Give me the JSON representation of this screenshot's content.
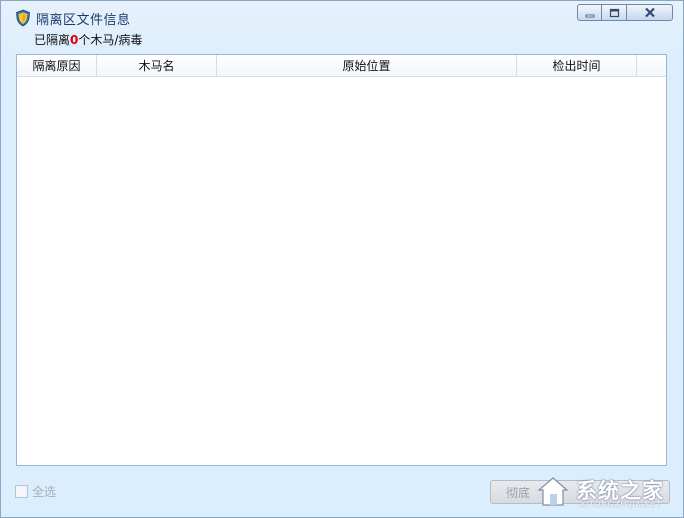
{
  "window": {
    "title": "隔离区文件信息",
    "summary_prefix": "已隔离",
    "summary_count": "0",
    "summary_suffix": "个木马/病毒"
  },
  "table": {
    "columns": [
      "隔离原因",
      "木马名",
      "原始位置",
      "检出时间"
    ],
    "rows": []
  },
  "footer": {
    "select_all_label": "全选",
    "action_button_label": "彻底"
  },
  "watermark": {
    "text": "系统之家",
    "subtext": "XITONGZHIJIA.NET"
  },
  "colors": {
    "count_color": "#e00000",
    "title_color": "#1b3b6e",
    "window_bg": "#dbeefd"
  }
}
